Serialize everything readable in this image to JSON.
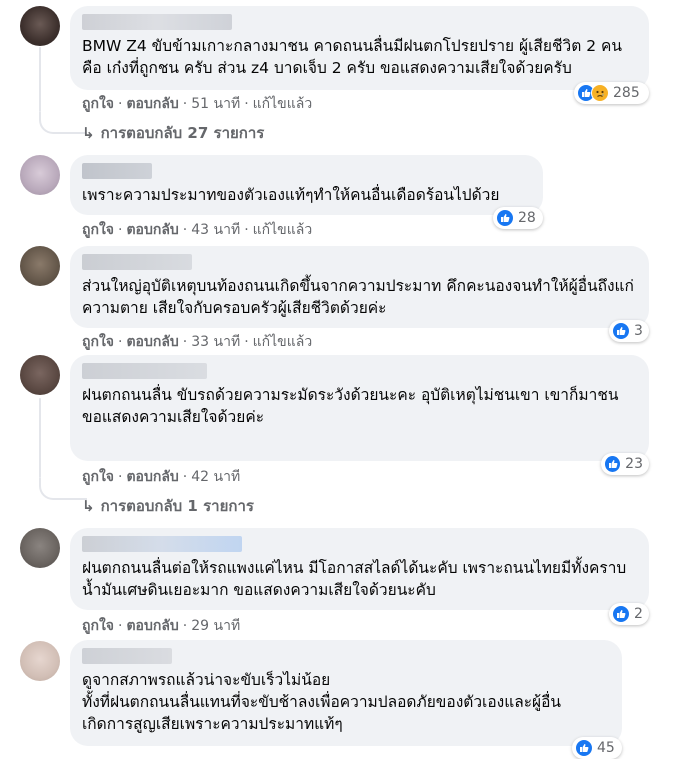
{
  "actions": {
    "like": "ถูกใจ",
    "reply": "ตอบกลับ",
    "edited": "แก้ไขแล้ว",
    "dot": "·"
  },
  "comments": [
    {
      "text": "BMW Z4 ขับข้ามเกาะกลางมาชน คาดถนนลื่นมีฝนตกโปรยปราย ผู้เสียชีวิต 2 คน คือ เก๋งที่ถูกชน ครับ ส่วน z4 บาดเจ็บ 2 ครับ ขอแสดงความเสียใจด้วยครับ",
      "time": "51 นาที",
      "edited": true,
      "reactions": [
        "like",
        "sad"
      ],
      "reaction_count": "285",
      "replies": "การตอบกลับ 27 รายการ"
    },
    {
      "text": "เพราะความประมาทของตัวเองแท้ๆทำให้คนอื่นเดือดร้อนไปด้วย",
      "time": "43 นาที",
      "edited": true,
      "reactions": [
        "like"
      ],
      "reaction_count": "28"
    },
    {
      "text": "ส่วนใหญ่อุบัติเหตุบนท้องถนนเกิดขึ้นจากความประมาท คึกคะนองจนทำให้ผู้อื่นถึงแก่ความตาย เสียใจกับครอบครัวผู้เสียชีวิตด้วยค่ะ",
      "time": "33 นาที",
      "edited": true,
      "reactions": [
        "like"
      ],
      "reaction_count": "3"
    },
    {
      "text": "ฝนตกถนนลื่น ขับรถด้วยความระมัดระวังด้วยนะคะ อุบัติเหตุไม่ชนเขา เขาก็มาชน\nขอแสดงความเสียใจด้วยค่ะ",
      "time": "42 นาที",
      "edited": false,
      "reactions": [
        "like"
      ],
      "reaction_count": "23",
      "replies": "การตอบกลับ 1 รายการ"
    },
    {
      "text": "ฝนตกถนนลื่นต่อให้รถแพงแค่ไหน มีโอกาสสไลด์ได้นะคับ เพราะถนนไทยมีทั้งคราบน้ำมันเศษดินเยอะมาก ขอแสดงความเสียใจด้วยนะคับ",
      "time": "29 นาที",
      "edited": false,
      "reactions": [
        "like"
      ],
      "reaction_count": "2"
    },
    {
      "text": "ดูจากสภาพรถแล้วน่าจะขับเร็วไม่น้อย\nทั้งที่ฝนตกถนนลื่นแทนที่จะขับช้าลงเพื่อความปลอดภัยของตัวเองและผู้อื่น\nเกิดการสูญเสียเพราะความประมาทแท้ๆ",
      "reactions": [
        "like"
      ],
      "reaction_count": "45"
    }
  ],
  "colors": {
    "bubble": "#f0f2f5",
    "meta": "#65676b",
    "like": "#1877f2",
    "sad": "#f7b125"
  },
  "icons": [
    "like-reaction-icon",
    "sad-reaction-icon",
    "reply-arrow-icon"
  ]
}
